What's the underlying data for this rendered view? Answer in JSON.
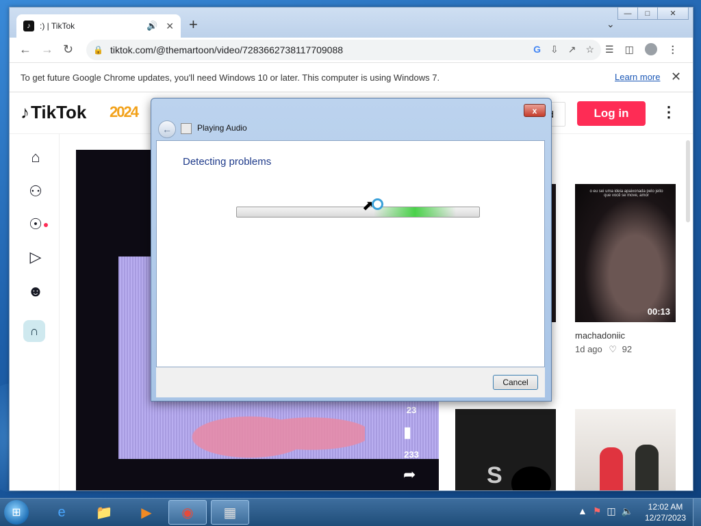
{
  "browser": {
    "tab": {
      "title": ":) | TikTok",
      "favicon": "♪"
    },
    "new_tab": "+",
    "tab_menu": "⌄",
    "window_controls": [
      "—",
      "□",
      "✕"
    ],
    "url": "tiktok.com/@themartoon/video/7283662738117709088",
    "infobar": {
      "message": "To get future Google Chrome updates, you'll need Windows 10 or later. This computer is using Windows 7.",
      "link": "Learn more",
      "close": "✕"
    }
  },
  "tiktok": {
    "logo": "TikTok",
    "badge": "2024",
    "login": "Log in",
    "upload_partial": "d",
    "video": {
      "saves": "23",
      "shares": "233"
    },
    "thumbs": [
      {
        "user": "machadoniic",
        "age": "1d ago",
        "likes": "92",
        "duration": "00:13",
        "caption": "o eu sei uma ideia apaixonada pelo jeito que você se move, amor"
      },
      {
        "user_partial": "a"
      },
      {
        "letter": "S"
      }
    ]
  },
  "dialog": {
    "title": "Playing Audio",
    "heading": "Detecting problems",
    "cancel": "Cancel",
    "close": "x"
  },
  "taskbar": {
    "time": "12:02 AM",
    "date": "12/27/2023"
  },
  "colors": {
    "tiktok_red": "#fe2c55",
    "dialog_heading": "#1e3a8a"
  }
}
